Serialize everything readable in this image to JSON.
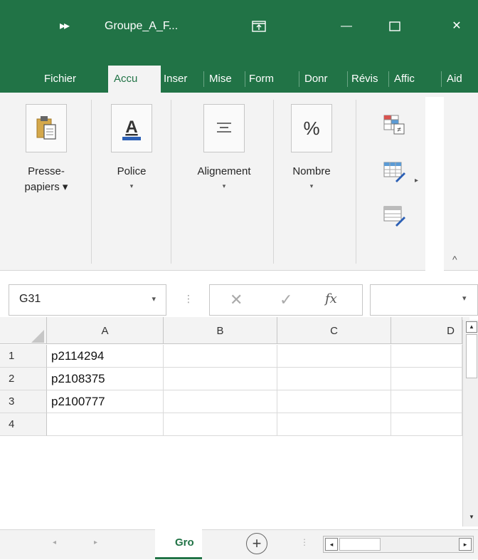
{
  "titlebar": {
    "qat_glyph": "▸▸",
    "title": "Groupe_A_F...",
    "minimize_glyph": "—",
    "close_glyph": "✕"
  },
  "tabs": [
    {
      "label": "Fichier"
    },
    {
      "label": "Accu"
    },
    {
      "label": "Inser"
    },
    {
      "label": "Mise"
    },
    {
      "label": "Form"
    },
    {
      "label": "Donr"
    },
    {
      "label": "Révis"
    },
    {
      "label": "Affic"
    },
    {
      "label": "Aid"
    }
  ],
  "ribbon": {
    "clipboard": {
      "line1": "Presse-",
      "line2": "papiers ▾"
    },
    "font": {
      "label": "Police"
    },
    "alignment": {
      "label": "Alignement"
    },
    "number": {
      "label": "Nombre",
      "icon_text": "%"
    },
    "arrow": "▾",
    "expand": "▸",
    "collapse": "^"
  },
  "formula_bar": {
    "name_box": "G31",
    "name_arrow": "▾",
    "dots": "⋮",
    "cancel": "✕",
    "enter": "✓",
    "fx": "fx",
    "input_arrow": "▾"
  },
  "grid": {
    "columns": [
      "A",
      "B",
      "C",
      "D"
    ],
    "rows": [
      {
        "num": "1",
        "a": "p2114294"
      },
      {
        "num": "2",
        "a": "p2108375"
      },
      {
        "num": "3",
        "a": "p2100777"
      },
      {
        "num": "4",
        "a": ""
      }
    ]
  },
  "sheets": {
    "prev": "◂",
    "next": "▸",
    "active_tab": "Gro",
    "add": "+",
    "dots": "⋮",
    "hs_left": "◂",
    "hs_right": "▸"
  },
  "vscroll": {
    "up": "▲",
    "down": "▼"
  },
  "colors": {
    "accent": "#217346"
  }
}
